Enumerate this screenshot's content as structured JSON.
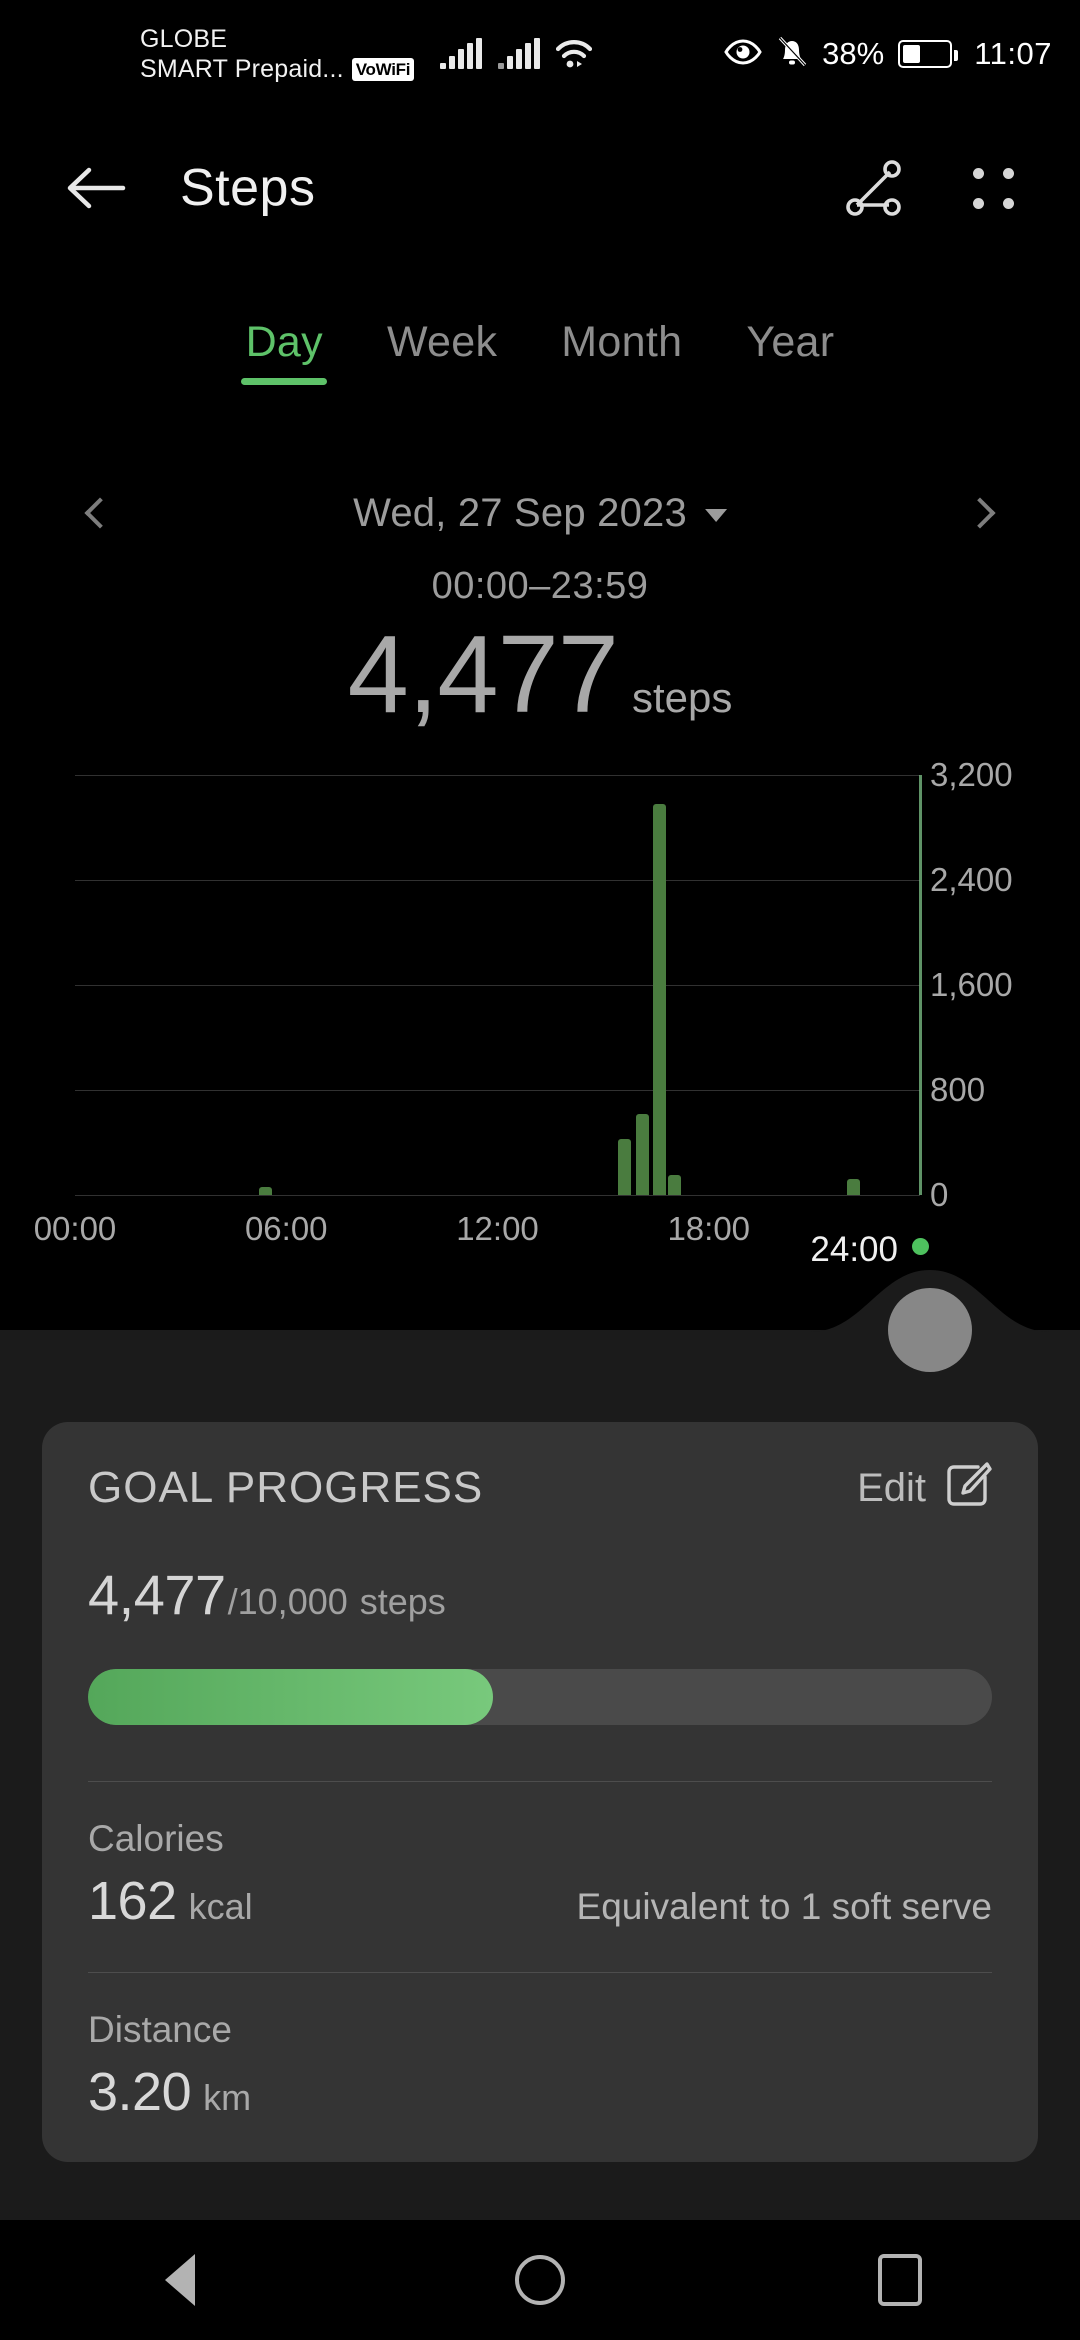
{
  "status_bar": {
    "carrier_line1": "GLOBE",
    "carrier_line2": "SMART Prepaid...",
    "vowifi_badge": "VoWiFi",
    "battery_percent": "38%",
    "clock": "11:07",
    "icons": [
      "signal-bars-icon",
      "signal-bars-icon",
      "wifi-icon",
      "eye-comfort-icon",
      "silent-bell-icon",
      "battery-icon"
    ]
  },
  "app_bar": {
    "title": "Steps",
    "back_icon": "back-arrow-icon",
    "share_icon": "share-nodes-icon",
    "menu_icon": "four-dots-menu-icon"
  },
  "tabs": {
    "items": [
      {
        "label": "Day",
        "active": true
      },
      {
        "label": "Week",
        "active": false
      },
      {
        "label": "Month",
        "active": false
      },
      {
        "label": "Year",
        "active": false
      }
    ],
    "active_color": "#5ec269",
    "inactive_color": "#8d8d8d"
  },
  "date_nav": {
    "prev_icon": "chevron-left-icon",
    "next_icon": "chevron-right-icon",
    "date": "Wed, 27 Sep 2023",
    "dropdown_icon": "caret-down-icon",
    "time_range": "00:00–23:59"
  },
  "summary": {
    "value": "4,477",
    "unit": "steps"
  },
  "chart_data": {
    "type": "bar",
    "title": "Steps per interval",
    "xlabel": "",
    "ylabel": "",
    "ylim": [
      0,
      3200
    ],
    "yticks": [
      0,
      800,
      1600,
      2400,
      3200
    ],
    "ytick_labels": [
      "0",
      "800",
      "1,600",
      "2,400",
      "3,200"
    ],
    "xticks_labels": [
      "00:00",
      "06:00",
      "12:00",
      "18:00"
    ],
    "xtick_hours": [
      0,
      6,
      12,
      18
    ],
    "xlim_hours": [
      0,
      24
    ],
    "grid": true,
    "bar_color": "#4a7c3f",
    "end_marker": {
      "label": "24:00",
      "dot_color": "#4ec15e"
    },
    "now_line_hour": 24,
    "points": [
      {
        "hour": 5.4,
        "value": 60
      },
      {
        "hour": 15.6,
        "value": 430
      },
      {
        "hour": 16.1,
        "value": 620
      },
      {
        "hour": 16.6,
        "value": 2980
      },
      {
        "hour": 17.0,
        "value": 155
      },
      {
        "hour": 22.1,
        "value": 120
      }
    ]
  },
  "goal_card": {
    "title": "GOAL PROGRESS",
    "edit_label": "Edit",
    "edit_icon": "pencil-square-icon",
    "current": "4,477",
    "target": "/10,000",
    "unit": "steps",
    "progress_percent": 44.8,
    "progress_color_start": "#54a75a",
    "progress_color_end": "#78c97c",
    "metrics": [
      {
        "label": "Calories",
        "value": "162",
        "unit": "kcal",
        "note": "Equivalent to 1 soft serve"
      },
      {
        "label": "Distance",
        "value": "3.20",
        "unit": "km",
        "note": ""
      }
    ]
  },
  "nav_bar": {
    "back": "back-triangle-icon",
    "home": "home-circle-icon",
    "recents": "recents-square-icon"
  }
}
